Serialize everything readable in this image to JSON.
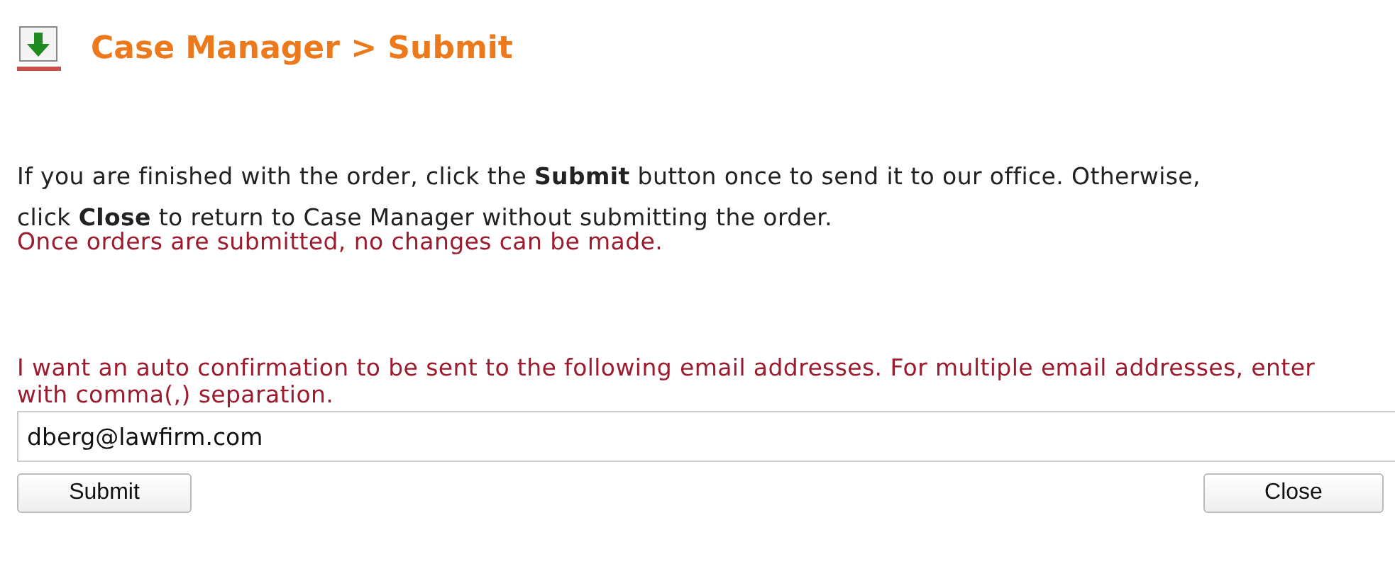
{
  "header": {
    "title": "Case Manager > Submit"
  },
  "instructions": [
    "If you are finished with the order, click the **Submit** button once to send it to our office. Otherwise,",
    "click **Close** to return to Case Manager without submitting the order."
  ],
  "warning": "Once orders are submitted, no changes can be made.",
  "email": {
    "label": "I want an auto confirmation to be sent to the following email addresses. For multiple email addresses, enter with comma(,) separation.",
    "value": "dberg@lawfirm.com"
  },
  "buttons": [
    "Submit",
    "Close"
  ]
}
